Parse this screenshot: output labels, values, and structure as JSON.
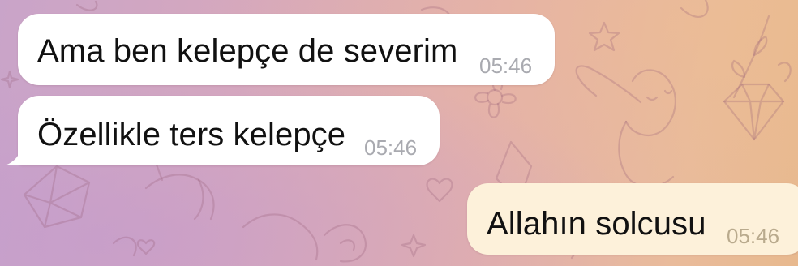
{
  "conversation": {
    "messages": [
      {
        "direction": "incoming",
        "text": "Ama ben kelepçe de severim",
        "time": "05:46"
      },
      {
        "direction": "incoming",
        "text": "Özellikle ters kelepçe",
        "time": "05:46"
      },
      {
        "direction": "outgoing",
        "text": "Allahın solcusu",
        "time": "05:46"
      }
    ]
  },
  "colors": {
    "incoming_bubble": "#ffffff",
    "outgoing_bubble": "#fdf1da",
    "background_start": "#c9a4c9",
    "background_end": "#e8b98e"
  },
  "icons": [
    "diamond-doodle",
    "bunny-doodle",
    "flower-doodle",
    "heart-doodle",
    "star-doodle",
    "unicorn-doodle",
    "leaf-doodle",
    "crystal-doodle"
  ]
}
